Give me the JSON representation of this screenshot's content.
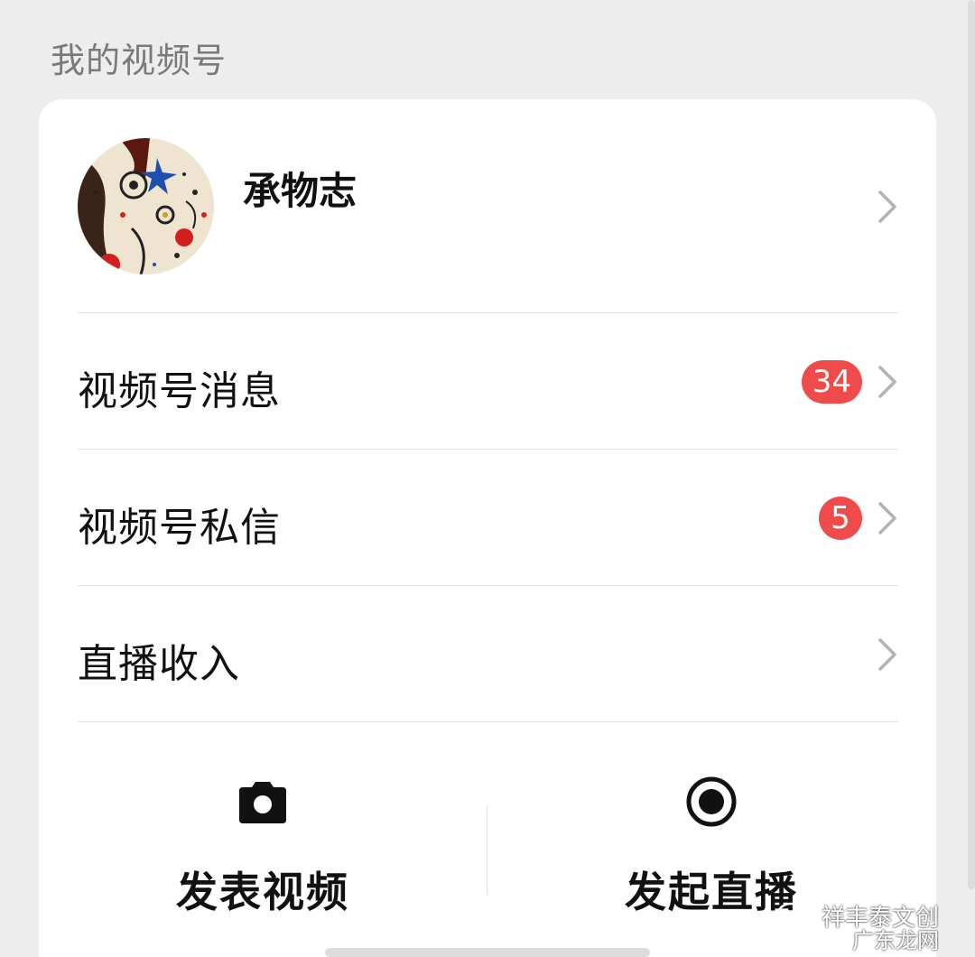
{
  "section": {
    "title": "我的视频号"
  },
  "profile": {
    "name": "承物志",
    "avatar_icon": "abstract-art-avatar"
  },
  "menu": {
    "items": [
      {
        "label": "视频号消息",
        "badge": "34"
      },
      {
        "label": "视频号私信",
        "badge": "5"
      },
      {
        "label": "直播收入",
        "badge": ""
      }
    ]
  },
  "actions": {
    "post_video": {
      "label": "发表视频",
      "icon": "camera-icon"
    },
    "start_live": {
      "label": "发起直播",
      "icon": "record-icon"
    }
  },
  "watermark": {
    "line1": "祥丰泰文创",
    "line2": "广东龙网"
  },
  "colors": {
    "badge": "#f04b4b",
    "background": "#ededed",
    "card": "#ffffff"
  }
}
